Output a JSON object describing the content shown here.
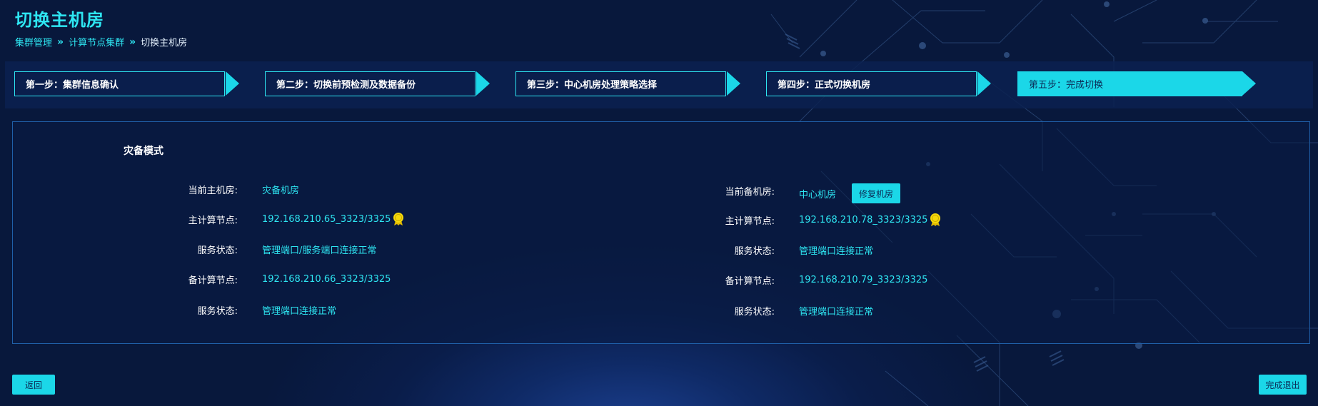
{
  "page": {
    "title": "切换主机房"
  },
  "breadcrumb": {
    "items": [
      "集群管理",
      "计算节点集群",
      "切换主机房"
    ],
    "separator": "»"
  },
  "steps": [
    {
      "label": "第一步：集群信息确认",
      "active": false
    },
    {
      "label": "第二步：切换前预检测及数据备份",
      "active": false
    },
    {
      "label": "第三步：中心机房处理策略选择",
      "active": false
    },
    {
      "label": "第四步：正式切换机房",
      "active": false
    },
    {
      "label": "第五步：完成切换",
      "active": true
    }
  ],
  "panel": {
    "mode_title": "灾备模式",
    "left": {
      "current_master_room": {
        "label": "当前主机房:",
        "value": "灾备机房"
      },
      "master_node": {
        "label": "主计算节点:",
        "value": "192.168.210.65_3323/3325",
        "badge": "vip-badge-icon"
      },
      "master_service": {
        "label": "服务状态:",
        "value": "管理端口/服务端口连接正常"
      },
      "backup_node": {
        "label": "备计算节点:",
        "value": "192.168.210.66_3323/3325"
      },
      "backup_service": {
        "label": "服务状态:",
        "value": "管理端口连接正常"
      }
    },
    "right": {
      "current_backup_room": {
        "label": "当前备机房:",
        "value": "中心机房",
        "button": "修复机房"
      },
      "master_node": {
        "label": "主计算节点:",
        "value": "192.168.210.78_3323/3325",
        "badge": "vip-badge-icon"
      },
      "master_service": {
        "label": "服务状态:",
        "value": "管理端口连接正常"
      },
      "backup_node": {
        "label": "备计算节点:",
        "value": "192.168.210.79_3323/3325"
      },
      "backup_service": {
        "label": "服务状态:",
        "value": "管理端口连接正常"
      }
    }
  },
  "footer": {
    "back_label": "返回",
    "finish_label": "完成退出"
  },
  "colors": {
    "accent": "#1bd7e8",
    "title": "#2ee6f2",
    "background": "#08183c",
    "panel_border": "#1f5fa8",
    "badge": "#f5d90a"
  }
}
